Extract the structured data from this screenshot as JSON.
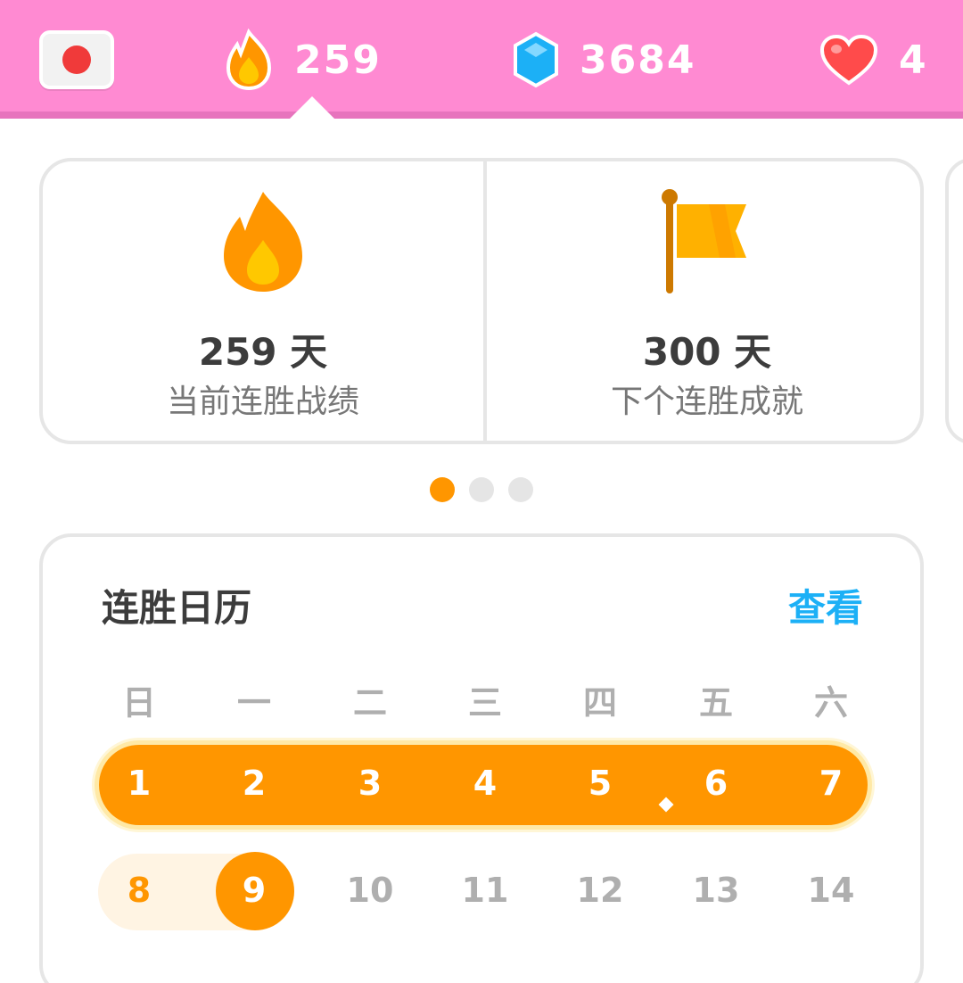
{
  "topbar": {
    "language_flag": "japan-flag",
    "streak": "259",
    "gems": "3684",
    "hearts": "4",
    "colors": {
      "background": "#ff8ad2",
      "streak": "#ff9600",
      "gem": "#1cb0f6",
      "heart": "#ff4b4b"
    }
  },
  "stats_cards": [
    {
      "icon": "flame-icon",
      "value": "259 天",
      "label": "当前连胜战绩"
    },
    {
      "icon": "flag-icon",
      "value": "300 天",
      "label": "下个连胜成就"
    }
  ],
  "carousel": {
    "pages": 3,
    "active": 1
  },
  "calendar": {
    "title": "连胜日历",
    "link": "查看",
    "weekdays": [
      "日",
      "一",
      "二",
      "三",
      "四",
      "五",
      "六"
    ],
    "week1": [
      "1",
      "2",
      "3",
      "4",
      "5",
      "6",
      "7"
    ],
    "week2": [
      "8",
      "9",
      "10",
      "11",
      "12",
      "13",
      "14"
    ],
    "today": "9"
  }
}
